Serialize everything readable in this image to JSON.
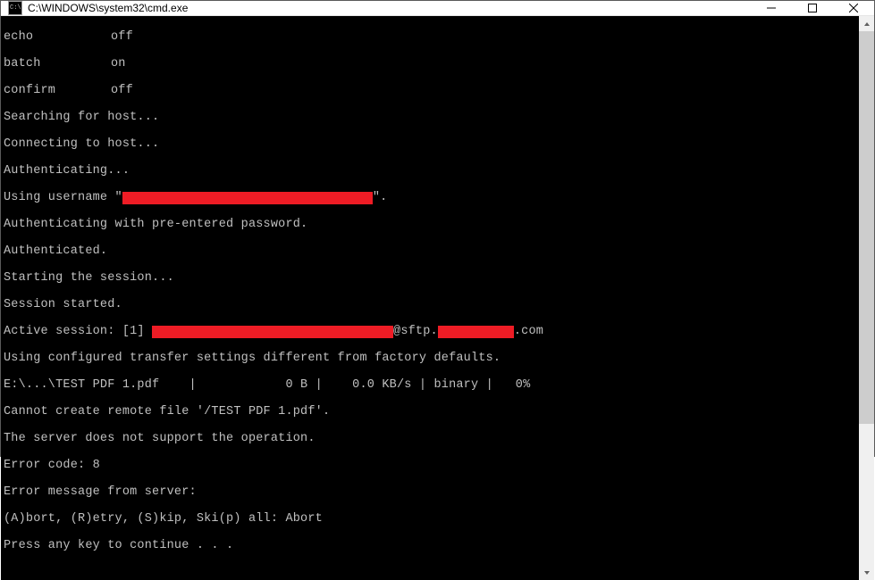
{
  "titlebar": {
    "title": "C:\\WINDOWS\\system32\\cmd.exe"
  },
  "terminal": {
    "setting_echo_label": "echo",
    "setting_echo_value": "off",
    "setting_batch_label": "batch",
    "setting_batch_value": "on",
    "setting_confirm_label": "confirm",
    "setting_confirm_value": "off",
    "l4": "Searching for host...",
    "l5": "Connecting to host...",
    "l6": "Authenticating...",
    "l7a": "Using username \"",
    "l7b": "\".",
    "l8": "Authenticating with pre-entered password.",
    "l9": "Authenticated.",
    "l10": "Starting the session...",
    "l11": "Session started.",
    "l12a": "Active session: [1] ",
    "l12b": "@sftp.",
    "l12c": ".com",
    "l13": "Using configured transfer settings different from factory defaults.",
    "l14": "E:\\...\\TEST PDF 1.pdf    |            0 B |    0.0 KB/s | binary |   0%",
    "l15": "Cannot create remote file '/TEST PDF 1.pdf'.",
    "l16": "The server does not support the operation.",
    "l17": "Error code: 8",
    "l18": "Error message from server:",
    "l19": "(A)bort, (R)etry, (S)kip, Ski(p) all: Abort",
    "l20": "Press any key to continue . . ."
  },
  "redactions": {
    "username_width": 280,
    "session_user_width": 270,
    "session_host_width": 85
  }
}
